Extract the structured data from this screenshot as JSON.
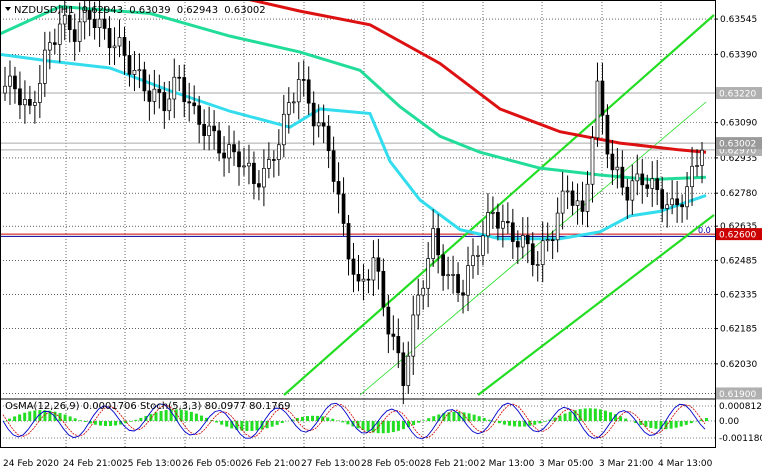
{
  "header": {
    "symbol": "NZDUSD,H1",
    "open": "0.62943",
    "high": "0.63039",
    "low": "0.62943",
    "close": "0.63002",
    "dropdown_icon": "triangle-down-icon"
  },
  "colors": {
    "background": "#ffffff",
    "candles": "#000000",
    "ema_fast": "#33ddee",
    "ema_mid": "#22dd99",
    "ema_slow": "#dd1111",
    "channel": "#22dd22",
    "price_tag": "#b0b0b0",
    "support_tag": "#cc0000",
    "osma_bars": "#22dd22",
    "stoch_main": "#0000cc",
    "stoch_signal": "#cc0000",
    "fib_line": "#000099"
  },
  "price_axis": {
    "labels": [
      "0.63545",
      "0.63390",
      "0.63220",
      "0.63090",
      "0.62935",
      "0.62780",
      "0.62635",
      "0.62485",
      "0.62335",
      "0.62185",
      "0.62030",
      "0.61900"
    ],
    "tags": {
      "current_price": "0.63002",
      "level_2970": "0.62970",
      "level_3220": "0.63220",
      "support": "0.62600",
      "low": "0.61900"
    }
  },
  "fib_label": "0.0",
  "time_axis": {
    "labels": [
      "24 Feb 2020",
      "24 Feb 21:00",
      "25 Feb 13:00",
      "26 Feb 05:00",
      "26 Feb 21:00",
      "27 Feb 13:00",
      "28 Feb 05:00",
      "28 Feb 21:00",
      "2 Mar 13:00",
      "3 Mar 05:00",
      "3 Mar 21:00",
      "4 Mar 13:00"
    ]
  },
  "subwindow": {
    "label": "OsMA(12,26,9) 0.0001706  Stoch(5,3,3) 80.0977 80.1769",
    "axis_labels": [
      "0.0008125",
      "0.00",
      "-0.0011800"
    ]
  },
  "chart_data": {
    "type": "candlestick",
    "symbol": "NZDUSD",
    "timeframe": "H1",
    "ylim": [
      0.6188,
      0.6362
    ],
    "support_level": 0.626,
    "resistance_levels": [
      0.6322,
      0.6297
    ],
    "overlays": [
      "ema-fast",
      "ema-mid",
      "ema-slow",
      "ascending-channel"
    ],
    "indicators": [
      {
        "name": "OsMA(12,26,9)",
        "value": 0.0001706
      },
      {
        "name": "Stoch(5,3,3)",
        "main": 80.0977,
        "signal": 80.1769
      }
    ],
    "closes_approx": [
      0.6325,
      0.6313,
      0.6337,
      0.6353,
      0.6349,
      0.6357,
      0.6348,
      0.6342,
      0.6331,
      0.6322,
      0.6318,
      0.6328,
      0.6312,
      0.6305,
      0.6296,
      0.6294,
      0.6283,
      0.6289,
      0.6309,
      0.6329,
      0.6312,
      0.6299,
      0.6262,
      0.6235,
      0.6249,
      0.622,
      0.6197,
      0.6232,
      0.6258,
      0.624,
      0.6236,
      0.6255,
      0.627,
      0.6261,
      0.6256,
      0.6248,
      0.6262,
      0.6281,
      0.6267,
      0.6323,
      0.6288,
      0.6279,
      0.6285,
      0.6278,
      0.6271,
      0.6279,
      0.63
    ]
  }
}
